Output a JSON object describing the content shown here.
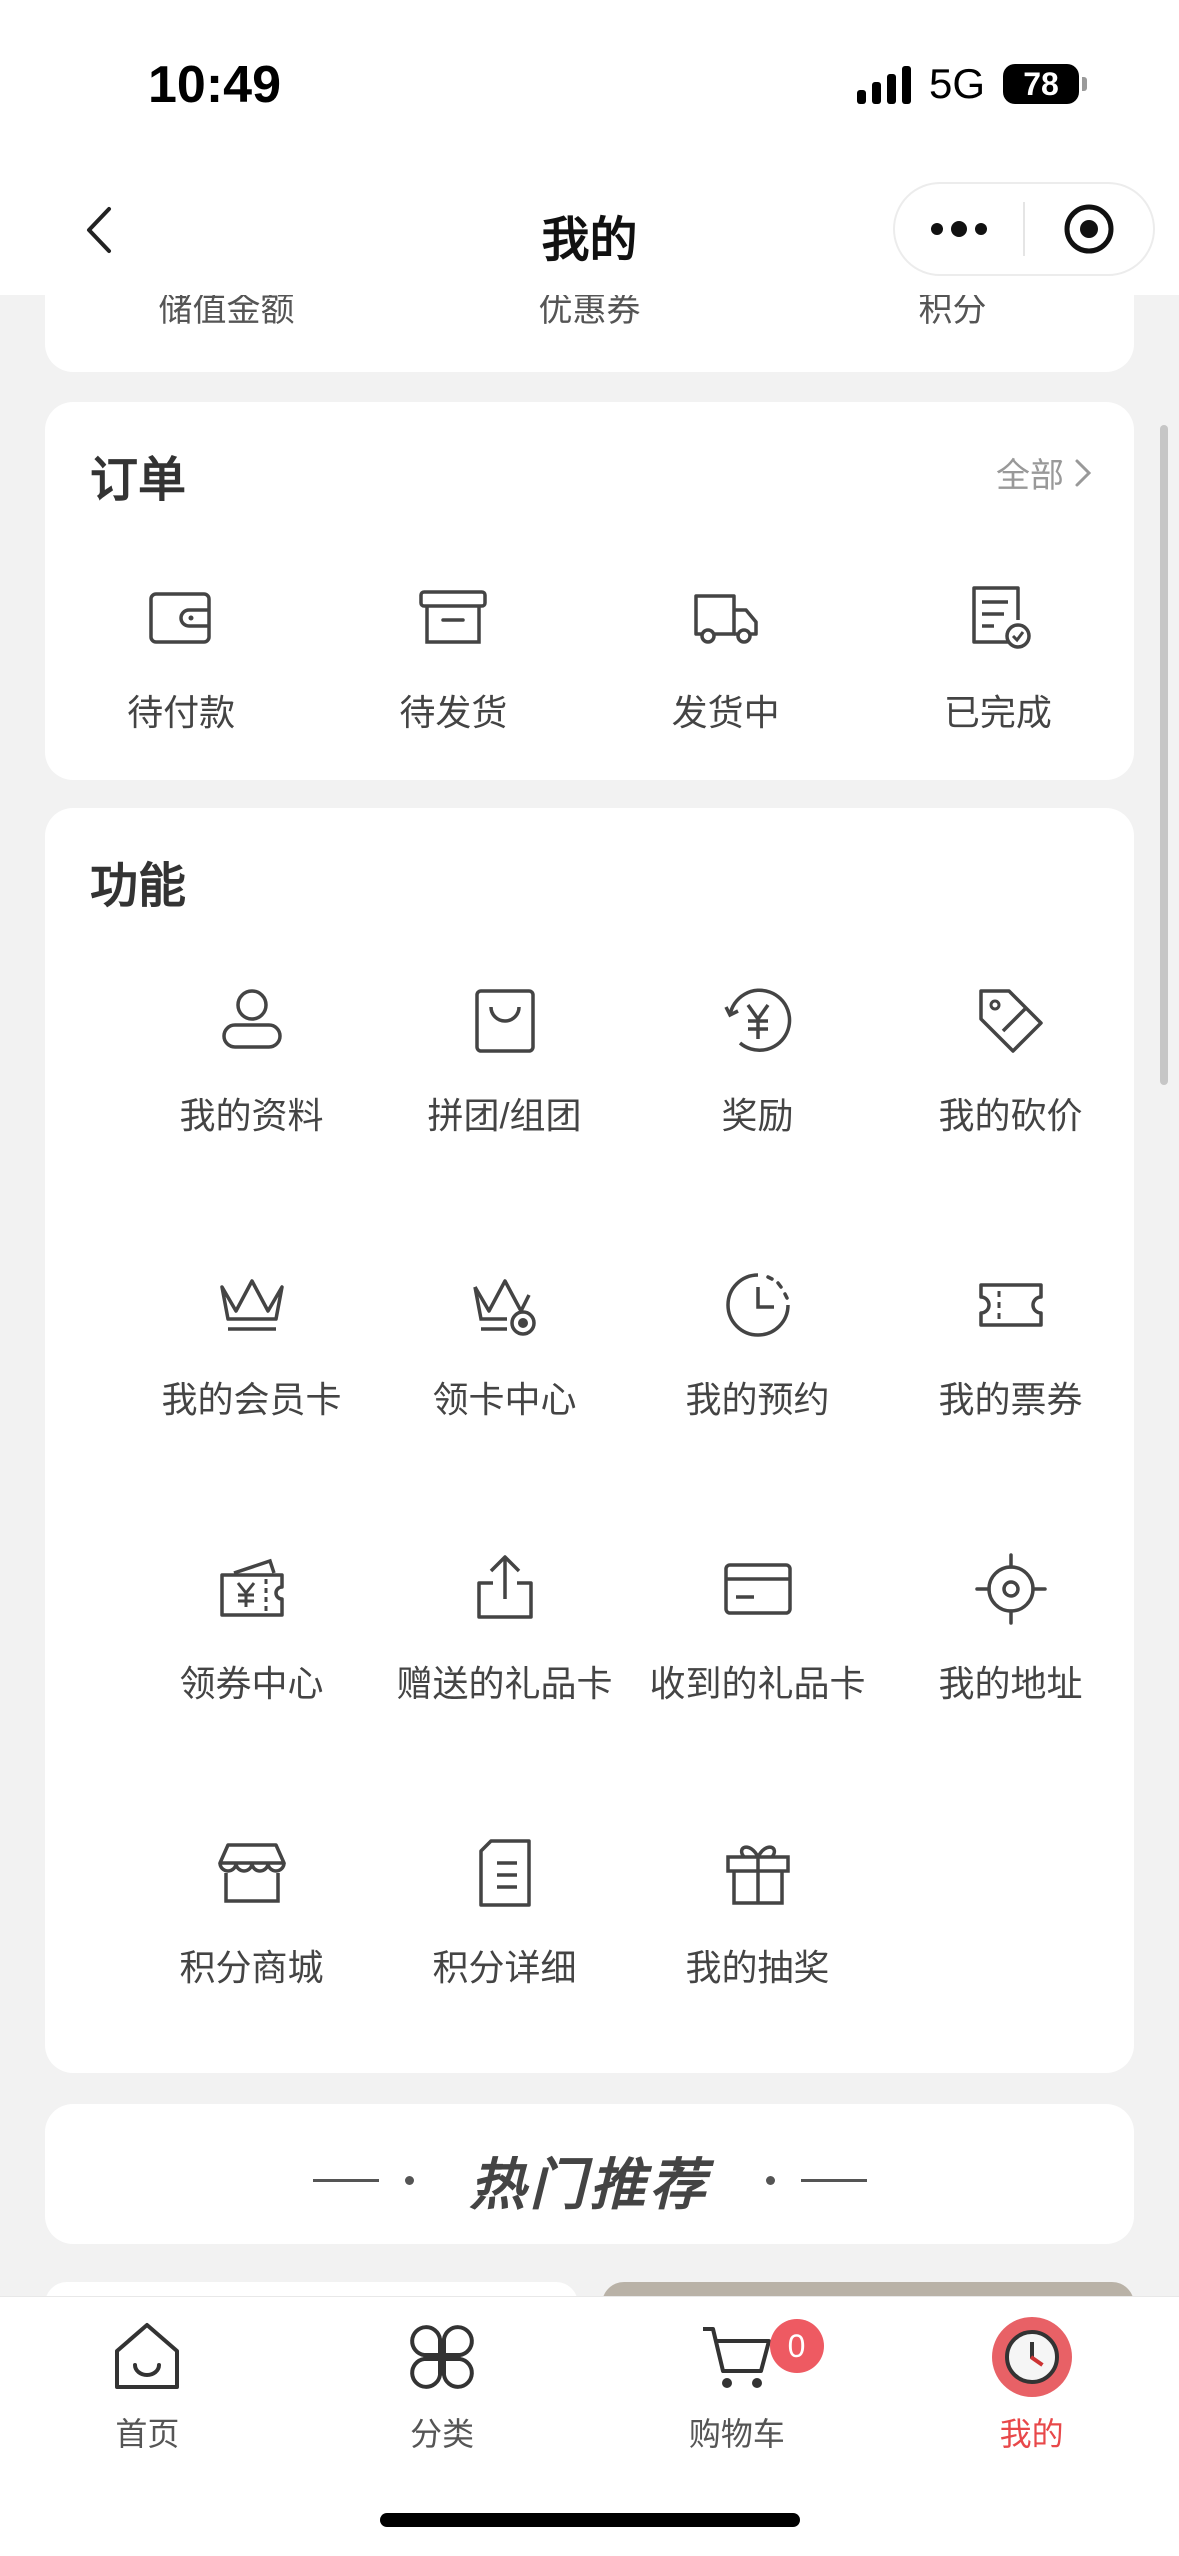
{
  "status": {
    "time": "10:49",
    "network": "5G",
    "battery": "78"
  },
  "nav": {
    "title": "我的"
  },
  "assets": {
    "items": [
      "储值金额",
      "优惠券",
      "积分"
    ]
  },
  "orders": {
    "title": "订单",
    "all_label": "全部",
    "items": [
      {
        "label": "待付款",
        "icon": "wallet-icon"
      },
      {
        "label": "待发货",
        "icon": "box-icon"
      },
      {
        "label": "发货中",
        "icon": "truck-icon"
      },
      {
        "label": "已完成",
        "icon": "checked-doc-icon"
      }
    ]
  },
  "functions": {
    "title": "功能",
    "items": [
      {
        "label": "我的资料",
        "icon": "profile-icon"
      },
      {
        "label": "拼团/组团",
        "icon": "shopping-bag-icon"
      },
      {
        "label": "奖励",
        "icon": "yen-reward-icon"
      },
      {
        "label": "我的砍价",
        "icon": "price-tag-icon"
      },
      {
        "label": "我的会员卡",
        "icon": "crown-icon"
      },
      {
        "label": "领卡中心",
        "icon": "crown-badge-icon"
      },
      {
        "label": "我的预约",
        "icon": "clock-icon"
      },
      {
        "label": "我的票券",
        "icon": "ticket-icon"
      },
      {
        "label": "领券中心",
        "icon": "coupon-icon"
      },
      {
        "label": "赠送的礼品卡",
        "icon": "share-icon"
      },
      {
        "label": "收到的礼品卡",
        "icon": "card-icon"
      },
      {
        "label": "我的地址",
        "icon": "location-target-icon"
      },
      {
        "label": "积分商城",
        "icon": "store-icon"
      },
      {
        "label": "积分详细",
        "icon": "document-icon"
      },
      {
        "label": "我的抽奖",
        "icon": "gift-icon"
      }
    ]
  },
  "hot": {
    "title": "热门推荐"
  },
  "tabbar": {
    "items": [
      {
        "label": "首页",
        "icon": "home-icon"
      },
      {
        "label": "分类",
        "icon": "category-icon"
      },
      {
        "label": "购物车",
        "icon": "cart-icon",
        "badge": "0"
      },
      {
        "label": "我的",
        "icon": "avatar-icon",
        "active": true
      }
    ],
    "active_color": "#e8484a",
    "badge_color": "#ee5a62"
  }
}
